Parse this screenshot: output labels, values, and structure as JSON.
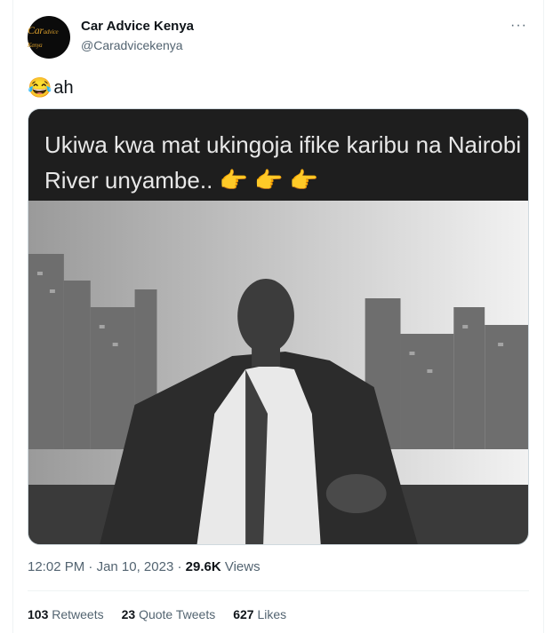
{
  "author": {
    "name": "Car Advice Kenya",
    "handle": "@Caradvicekenya",
    "avatar_logo_main": "Car",
    "avatar_logo_small": "advice Kenya"
  },
  "more_label": "···",
  "tweet": {
    "emoji": "😂",
    "text": "ah"
  },
  "media": {
    "caption": "Ukiwa kwa mat ukingoja ifike karibu na Nairobi River unyambe.. 👉 👉 👉"
  },
  "meta": {
    "time": "12:02 PM",
    "sep1": " · ",
    "date": "Jan 10, 2023",
    "sep2": " · ",
    "views_count": "29.6K",
    "views_label": " Views"
  },
  "stats": {
    "retweets_count": "103",
    "retweets_label": "Retweets",
    "quotes_count": "23",
    "quotes_label": "Quote Tweets",
    "likes_count": "627",
    "likes_label": "Likes"
  },
  "colors": {
    "text_primary": "#0f1419",
    "text_secondary": "#536471",
    "border": "#eff3f4"
  }
}
